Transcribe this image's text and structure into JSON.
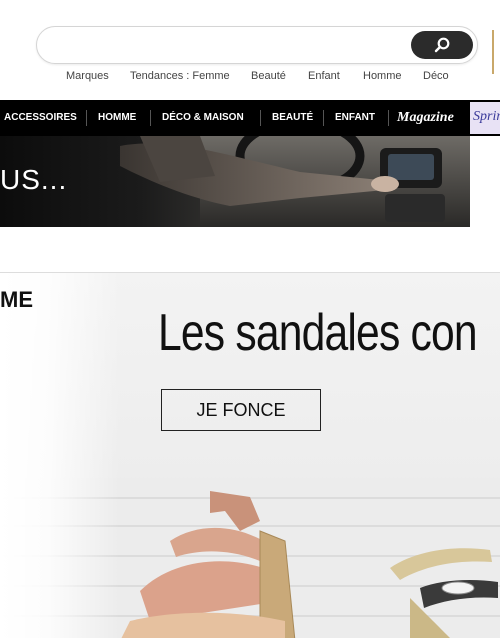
{
  "search": {
    "placeholder": ""
  },
  "quicklinks": [
    "Marques",
    "Tendances : Femme",
    "Beauté",
    "Enfant",
    "Homme",
    "Déco"
  ],
  "nav": {
    "items": [
      "ACCESSOIRES",
      "HOMME",
      "DÉCO & MAISON",
      "BEAUTÉ",
      "ENFANT"
    ],
    "magazine": "Magazine",
    "spring": "Spring"
  },
  "car_banner": {
    "title": "US..."
  },
  "promo": {
    "section_label": "ME",
    "headline": "Les sandales con",
    "cta": "JE FONCE"
  },
  "icons": {
    "search_button": "search-icon"
  },
  "colors": {
    "navbar": "#000000",
    "search_button": "#2b2b2b",
    "spring_bg": "#e8e2f5"
  }
}
